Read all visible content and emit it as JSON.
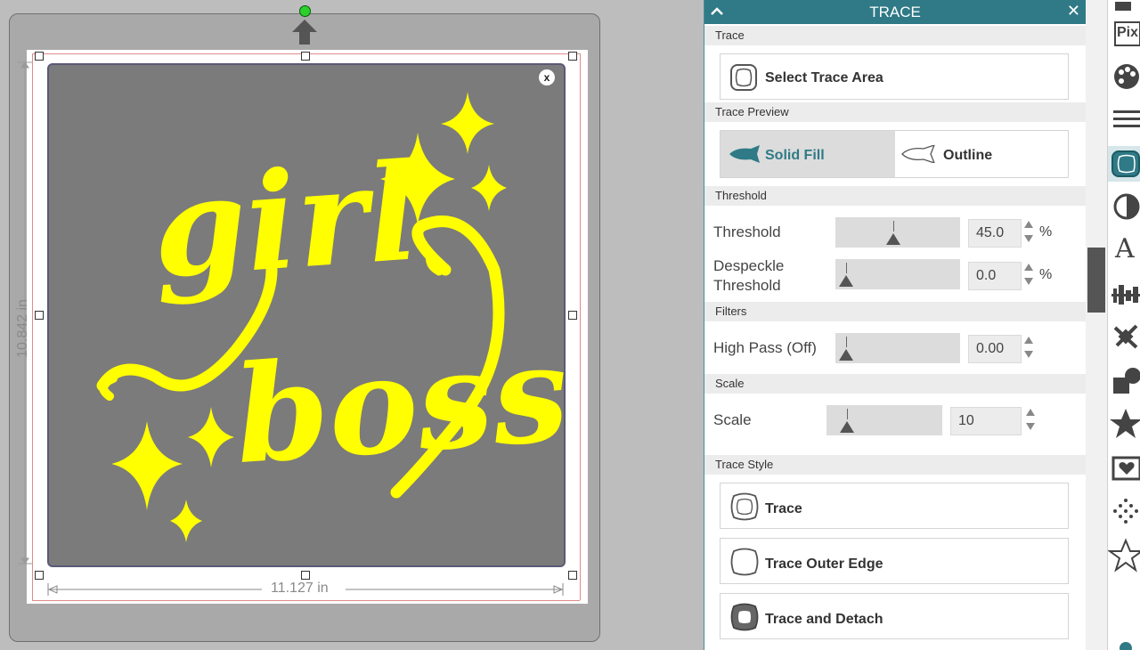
{
  "canvas": {
    "width_dimension": "11.127 in",
    "height_dimension": "10.842 in",
    "close_image_label": "x",
    "image_text_line1": "girl",
    "image_text_line2": "boss",
    "image_fill_color": "#ffff00",
    "image_background_color": "#7b7b7b"
  },
  "panel": {
    "title": "TRACE",
    "close_glyph": "✕",
    "accent_color": "#2f7a86",
    "sections": {
      "trace": "Trace",
      "trace_preview": "Trace Preview",
      "threshold": "Threshold",
      "filters": "Filters",
      "scale": "Scale",
      "trace_style": "Trace Style"
    },
    "select_trace_area_label": "Select Trace Area",
    "preview": {
      "solid_fill_label": "Solid Fill",
      "outline_label": "Outline",
      "selected": "Solid Fill"
    },
    "threshold": {
      "label": "Threshold",
      "value": "45.0",
      "unit": "%",
      "level": 0.45
    },
    "despeckle": {
      "label_line1": "Despeckle",
      "label_line2": "Threshold",
      "value": "0.0",
      "unit": "%",
      "level": 0
    },
    "high_pass": {
      "label": "High Pass (Off)",
      "value": "0.00",
      "level": 0
    },
    "scale": {
      "label": "Scale",
      "value": "10",
      "level": 0.1
    },
    "trace_buttons": {
      "trace": "Trace",
      "trace_outer_edge": "Trace Outer Edge",
      "trace_and_detach": "Trace and Detach"
    }
  },
  "toolbar": {
    "pix_label": "Pix",
    "text_tool_label": "A",
    "icons": [
      "send-icon",
      "pixscan-icon",
      "palette-icon",
      "line-style-icon",
      "trace-icon",
      "fill-icon",
      "text-icon",
      "align-icon",
      "transform-icon",
      "offset-icon",
      "star-icon",
      "heart-library-icon",
      "dots-icon",
      "outline-star-icon"
    ]
  }
}
